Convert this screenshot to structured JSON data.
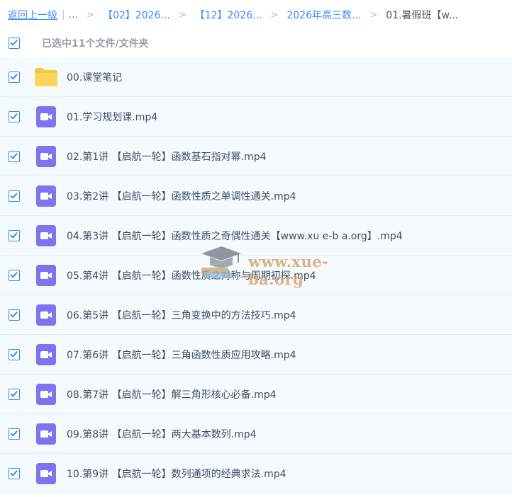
{
  "breadcrumb": {
    "back": "返回上一级",
    "ellipsis": "...",
    "items": [
      "【02】2026...",
      "【12】2026...",
      "2026年高三数...",
      "01.暑假班【w..."
    ],
    "separator": ">"
  },
  "selection": {
    "text": "已选中11个文件/文件夹",
    "checked": true
  },
  "files": [
    {
      "name": "00.课堂笔记",
      "type": "folder",
      "icon": "folder-icon"
    },
    {
      "name": "01.学习规划课.mp4",
      "type": "video",
      "icon": "video-icon"
    },
    {
      "name": "02.第1讲 【启航一轮】函数基石指对幂.mp4",
      "type": "video",
      "icon": "video-icon"
    },
    {
      "name": "03.第2讲 【启航一轮】函数性质之单调性通关.mp4",
      "type": "video",
      "icon": "video-icon"
    },
    {
      "name": "04.第3讲 【启航一轮】函数性质之奇偶性通关【www.xu e-b a.org】.mp4",
      "type": "video",
      "icon": "video-icon"
    },
    {
      "name": "05.第4讲 【启航一轮】函数性质之对称与周期初探.mp4",
      "type": "video",
      "icon": "video-icon"
    },
    {
      "name": "06.第5讲 【启航一轮】三角变换中的方法技巧.mp4",
      "type": "video",
      "icon": "video-icon"
    },
    {
      "name": "07.第6讲 【启航一轮】三角函数性质应用攻略.mp4",
      "type": "video",
      "icon": "video-icon"
    },
    {
      "name": "08.第7讲 【启航一轮】解三角形核心必备.mp4",
      "type": "video",
      "icon": "video-icon"
    },
    {
      "name": "09.第8讲 【启航一轮】两大基本数列.mp4",
      "type": "video",
      "icon": "video-icon"
    },
    {
      "name": "10.第9讲 【启航一轮】数列通项的经典求法.mp4",
      "type": "video",
      "icon": "video-icon"
    }
  ],
  "watermark": {
    "text": "www.xue-ba.org"
  },
  "colors": {
    "accent": "#3b8cff",
    "checkbox": "#2f8fe4",
    "row_bg": "#f5faff",
    "folder": "#fcd35c",
    "video": "#7f73f0"
  }
}
